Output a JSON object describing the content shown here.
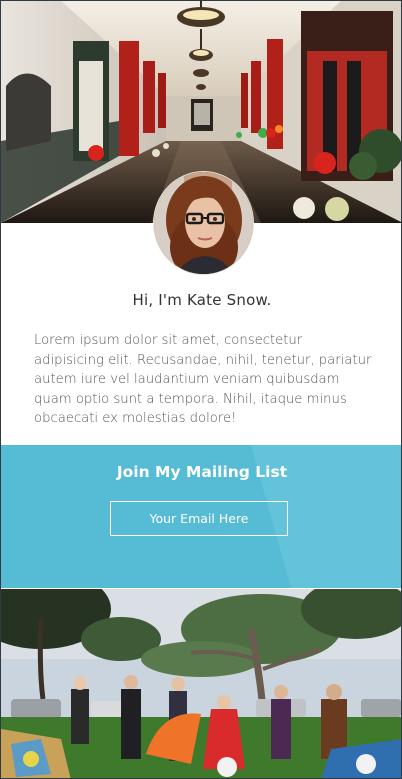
{
  "profile": {
    "greeting_prefix": "Hi, I'm",
    "name": "Kate Snow",
    "greeting_suffix": "."
  },
  "bio": {
    "text": "Lorem ipsum dolor sit amet, consectetur adipisicing elit. Recusandae, nihil, tenetur, pariatur autem iure vel laudantium veniam quibusdam quam optio sunt a tempora. Nihil, itaque minus obcaecati ex molestias dolore!"
  },
  "mailing_list": {
    "title": "Join My Mailing List",
    "email_placeholder": "Your Email Here",
    "email_value": ""
  },
  "colors": {
    "accent": "#58bfd9",
    "text": "#333333"
  }
}
